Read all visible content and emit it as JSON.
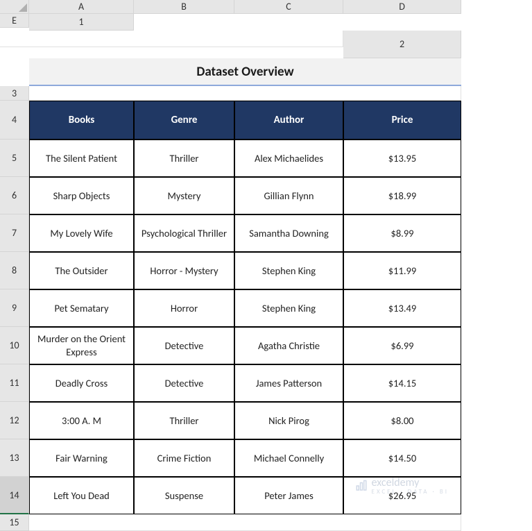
{
  "columns": [
    "A",
    "B",
    "C",
    "D",
    "E"
  ],
  "row_numbers": [
    "1",
    "2",
    "3",
    "4",
    "5",
    "6",
    "7",
    "8",
    "9",
    "10",
    "11",
    "12",
    "13",
    "14",
    "15"
  ],
  "title": "Dataset Overview",
  "headers": {
    "books": "Books",
    "genre": "Genre",
    "author": "Author",
    "price": "Price"
  },
  "rows": [
    {
      "book": "The Silent Patient",
      "genre": "Thriller",
      "author": "Alex Michaelides",
      "price": "$13.95"
    },
    {
      "book": "Sharp Objects",
      "genre": "Mystery",
      "author": "Gillian Flynn",
      "price": "$18.99"
    },
    {
      "book": "My Lovely Wife",
      "genre": "Psychological Thriller",
      "author": "Samantha Downing",
      "price": "$8.99"
    },
    {
      "book": "The Outsider",
      "genre": "Horror - Mystery",
      "author": "Stephen King",
      "price": "$11.99"
    },
    {
      "book": "Pet Sematary",
      "genre": "Horror",
      "author": "Stephen King",
      "price": "$13.49"
    },
    {
      "book": "Murder on the Orient Express",
      "genre": "Detective",
      "author": "Agatha Christie",
      "price": "$6.99"
    },
    {
      "book": "Deadly Cross",
      "genre": "Detective",
      "author": "James Patterson",
      "price": "$14.15"
    },
    {
      "book": "3:00 A. M",
      "genre": "Thriller",
      "author": "Nick Pirog",
      "price": "$8.00"
    },
    {
      "book": "Fair Warning",
      "genre": "Crime Fiction",
      "author": "Michael Connelly",
      "price": "$14.50"
    },
    {
      "book": "Left You Dead",
      "genre": "Suspense",
      "author": "Peter James",
      "price": "$26.95"
    }
  ],
  "watermark": {
    "brand": "exceldemy",
    "tag": "EXCEL · DATA · BI"
  },
  "chart_data": {
    "type": "table",
    "title": "Dataset Overview",
    "columns": [
      "Books",
      "Genre",
      "Author",
      "Price"
    ],
    "rows": [
      [
        "The Silent Patient",
        "Thriller",
        "Alex Michaelides",
        13.95
      ],
      [
        "Sharp Objects",
        "Mystery",
        "Gillian Flynn",
        18.99
      ],
      [
        "My Lovely Wife",
        "Psychological Thriller",
        "Samantha Downing",
        8.99
      ],
      [
        "The Outsider",
        "Horror - Mystery",
        "Stephen King",
        11.99
      ],
      [
        "Pet Sematary",
        "Horror",
        "Stephen King",
        13.49
      ],
      [
        "Murder on the Orient Express",
        "Detective",
        "Agatha Christie",
        6.99
      ],
      [
        "Deadly Cross",
        "Detective",
        "James Patterson",
        14.15
      ],
      [
        "3:00 A. M",
        "Thriller",
        "Nick Pirog",
        8.0
      ],
      [
        "Fair Warning",
        "Crime Fiction",
        "Michael Connelly",
        14.5
      ],
      [
        "Left You Dead",
        "Suspense",
        "Peter James",
        26.95
      ]
    ]
  }
}
